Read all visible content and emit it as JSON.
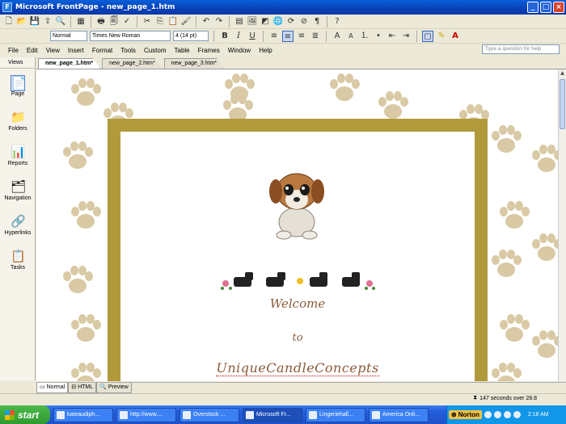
{
  "window": {
    "title": "Microsoft FrontPage - new_page_1.htm",
    "minimize": "_",
    "maximize": "□",
    "close": "×"
  },
  "toolbar": {
    "style": "Normal",
    "font": "Times New Roman",
    "size": "4 (14 pt)"
  },
  "menu": [
    "File",
    "Edit",
    "View",
    "Insert",
    "Format",
    "Tools",
    "Custom",
    "Table",
    "Frames",
    "Window",
    "Help"
  ],
  "ask_placeholder": "Type a question for help",
  "views": {
    "header": "Views",
    "items": [
      {
        "label": "Page",
        "icon": "page-view-icon",
        "active": true
      },
      {
        "label": "Folders",
        "icon": "folders-icon"
      },
      {
        "label": "Reports",
        "icon": "reports-icon"
      },
      {
        "label": "Navigation",
        "icon": "navigation-icon"
      },
      {
        "label": "Hyperlinks",
        "icon": "hyperlinks-icon"
      },
      {
        "label": "Tasks",
        "icon": "tasks-icon"
      }
    ]
  },
  "doc_tabs": [
    "new_page_1.htm*",
    "new_page_2.htm*",
    "new_page_3.htm*"
  ],
  "page": {
    "welcome": "Welcome",
    "to": "to",
    "company": "UniqueCandleConcepts",
    "colors": {
      "frame": "#b19a3b",
      "paw": "#d9c9a4",
      "text": "#8a5a3a"
    }
  },
  "view_tabs": [
    "Normal",
    "HTML",
    "Preview"
  ],
  "status": {
    "download": "147 seconds over 28.8"
  },
  "taskbar": {
    "start": "start",
    "buttons": [
      "kateaudiph...",
      "http://www....",
      "Overstock ...",
      "Microsoft Fr...",
      "Lingeriehall...",
      "America Onli..."
    ],
    "active_index": 3,
    "norton": "Norton",
    "time": "2:18 AM"
  }
}
